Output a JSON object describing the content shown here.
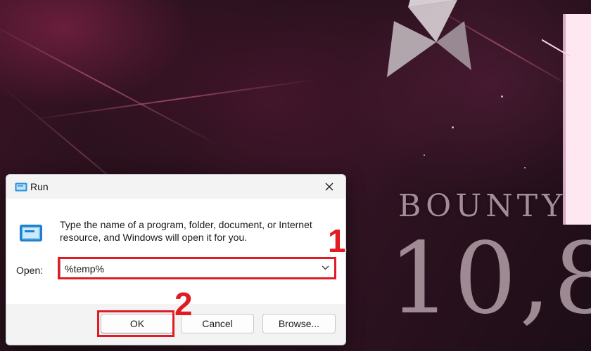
{
  "background": {
    "wallpaper_text": "BOUNTY",
    "wallpaper_number": "10,8"
  },
  "dialog": {
    "title": "Run",
    "title_icon": "run-icon",
    "close_icon": "close-icon",
    "description": "Type the name of a program, folder, document, or Internet resource, and Windows will open it for you.",
    "open_label": "Open:",
    "open_value": "%temp%",
    "dropdown_icon": "chevron-down-icon",
    "buttons": {
      "ok": "OK",
      "cancel": "Cancel",
      "browse": "Browse..."
    }
  },
  "annotations": {
    "step1": "1",
    "step2": "2",
    "color": "#e01b24"
  }
}
